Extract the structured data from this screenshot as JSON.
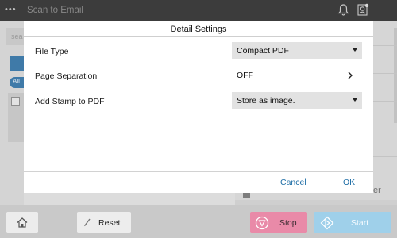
{
  "topbar": {
    "menu_glyph": "•••",
    "title": "Scan to Email",
    "bell_icon": "bell-icon",
    "user_icon": "user-status-icon"
  },
  "background": {
    "search_stub": "sea",
    "all_label": "All",
    "peek_text": "er"
  },
  "dialog": {
    "title": "Detail Settings",
    "settings": [
      {
        "label": "File Type",
        "value": "Compact PDF",
        "control": "dropdown"
      },
      {
        "label": "Page Separation",
        "value": "OFF",
        "control": "navigate"
      },
      {
        "label": "Add Stamp to PDF",
        "value": "Store as image.",
        "control": "dropdown"
      }
    ],
    "cancel_label": "Cancel",
    "ok_label": "OK"
  },
  "bottombar": {
    "home_icon": "home-icon",
    "reset_label": "Reset",
    "stop_label": "Stop",
    "start_label": "Start"
  },
  "colors": {
    "accent_link": "#1f6ea6",
    "stop": "#e98aa8",
    "start": "#9fd0ea",
    "topbar": "#3c3c3c"
  }
}
